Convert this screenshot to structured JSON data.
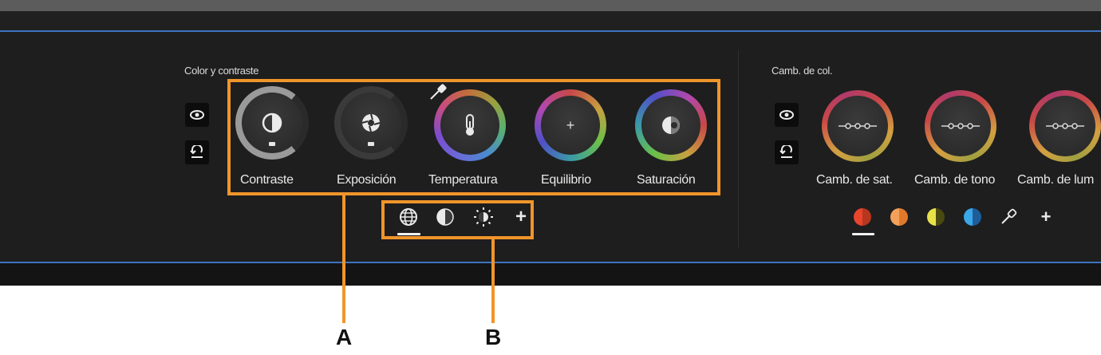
{
  "left_section": {
    "title": "Color y contraste",
    "dials": [
      {
        "label": "Contraste"
      },
      {
        "label": "Exposición"
      },
      {
        "label": "Temperatura"
      },
      {
        "label": "Equilibrio",
        "center_symbol": "+"
      },
      {
        "label": "Saturación"
      }
    ],
    "mode_icons": [
      "globe-icon",
      "half-circle-icon",
      "sun-icon",
      "plus-icon"
    ],
    "plus_symbol": "+"
  },
  "right_section": {
    "title": "Camb. de col.",
    "dials": [
      {
        "label": "Camb. de sat."
      },
      {
        "label": "Camb. de tono"
      },
      {
        "label": "Camb. de lum"
      }
    ],
    "plus_symbol": "+",
    "swatches": [
      {
        "left": "#e8452c",
        "right": "#b8351f"
      },
      {
        "left": "#f3a15a",
        "right": "#e07a2a"
      },
      {
        "left": "#e8e14a",
        "right": "#4a4a10"
      },
      {
        "left": "#3aa8e8",
        "right": "#1d5e9a"
      }
    ]
  },
  "callouts": {
    "a": "A",
    "b": "B"
  },
  "colors": {
    "accent_orange": "#f0952b",
    "panel_border": "#3d74c0",
    "panel_bg": "#1e1e1e"
  }
}
